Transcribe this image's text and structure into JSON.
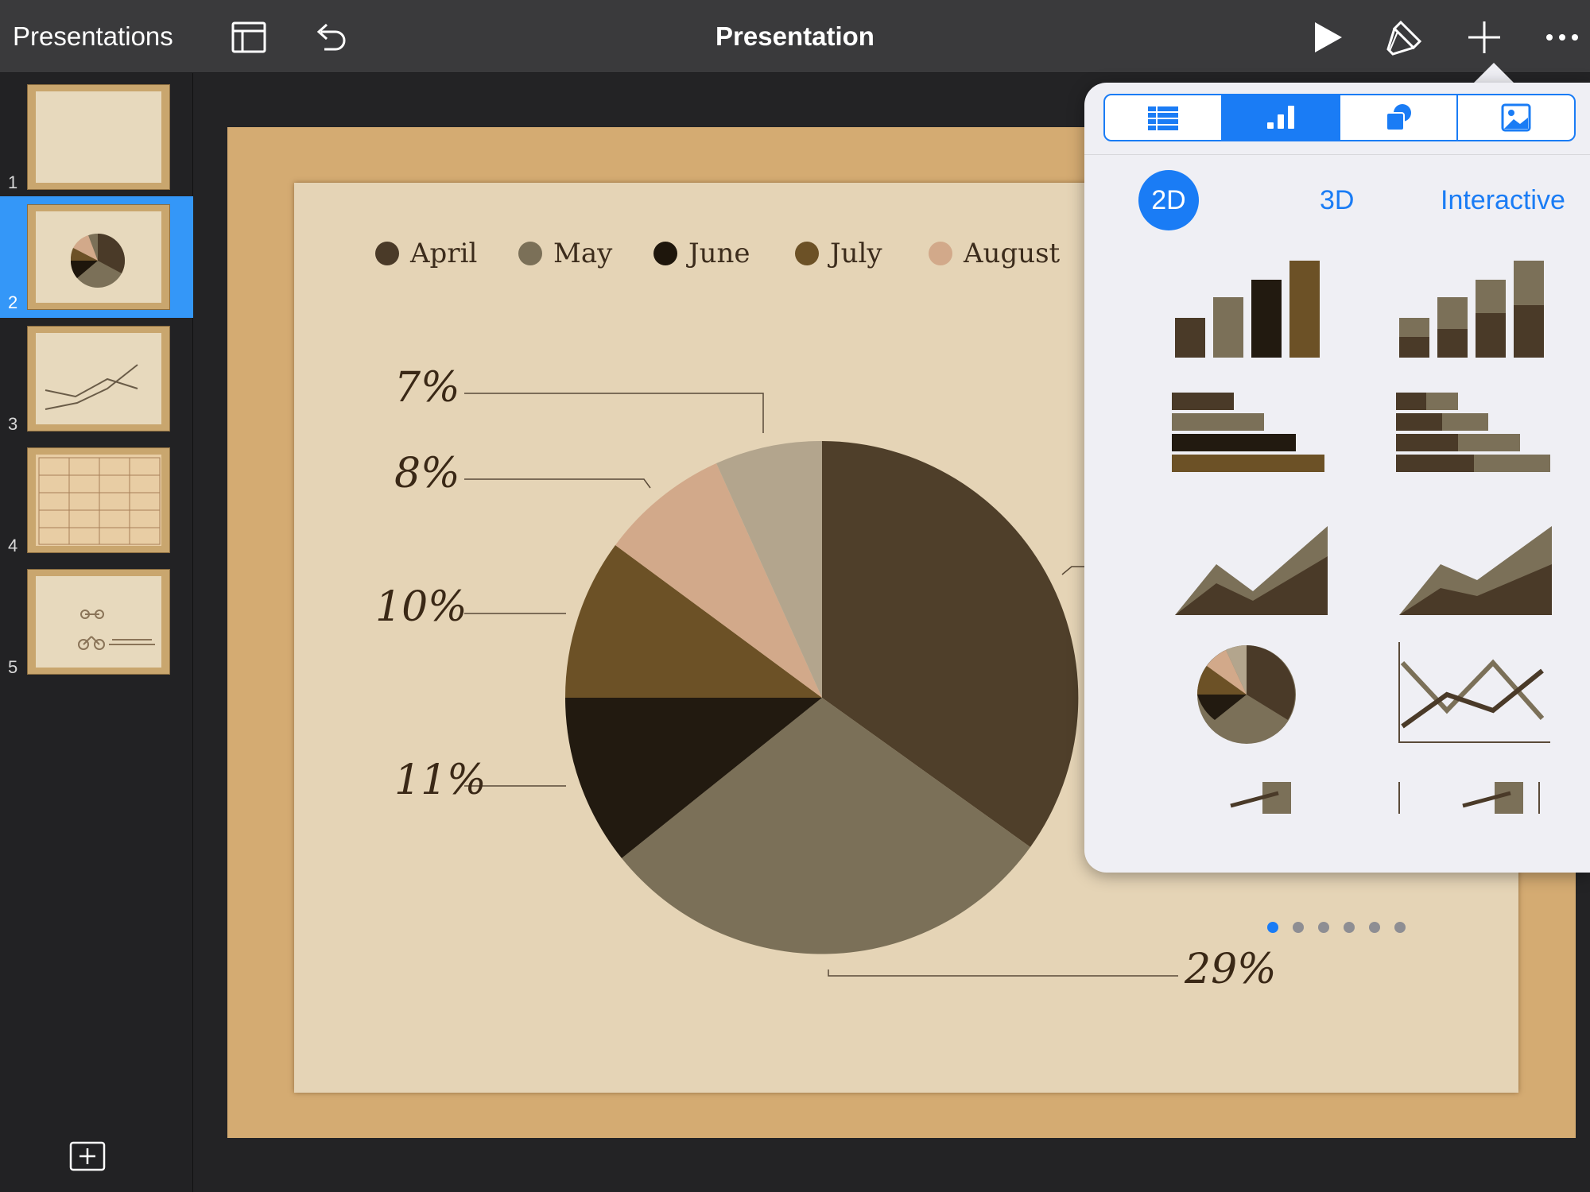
{
  "toolbar": {
    "back_label": "Presentations",
    "title": "Presentation"
  },
  "sidebar": {
    "slides": [
      {
        "number": "1"
      },
      {
        "number": "2",
        "selected": true
      },
      {
        "number": "3"
      },
      {
        "number": "4"
      },
      {
        "number": "5"
      }
    ]
  },
  "slide": {
    "legend": [
      "April",
      "May",
      "June",
      "July",
      "August"
    ],
    "legend_colors": [
      "#4a3a28",
      "#7b7058",
      "#1e160c",
      "#6c5126",
      "#d2a98a"
    ],
    "percent_labels": [
      "7%",
      "8%",
      "10%",
      "11%",
      "29%"
    ]
  },
  "popover": {
    "tabs": [
      "table-icon",
      "chart-icon",
      "shapes-icon",
      "media-icon"
    ],
    "active_tab": "chart-icon",
    "modes": [
      "2D",
      "3D",
      "Interactive"
    ],
    "active_mode": "2D",
    "page_count": 6,
    "active_page": 1
  },
  "colors": {
    "accent": "#1a7cf5",
    "selection": "#3497f8",
    "toolbar": "#3a3a3c"
  }
}
